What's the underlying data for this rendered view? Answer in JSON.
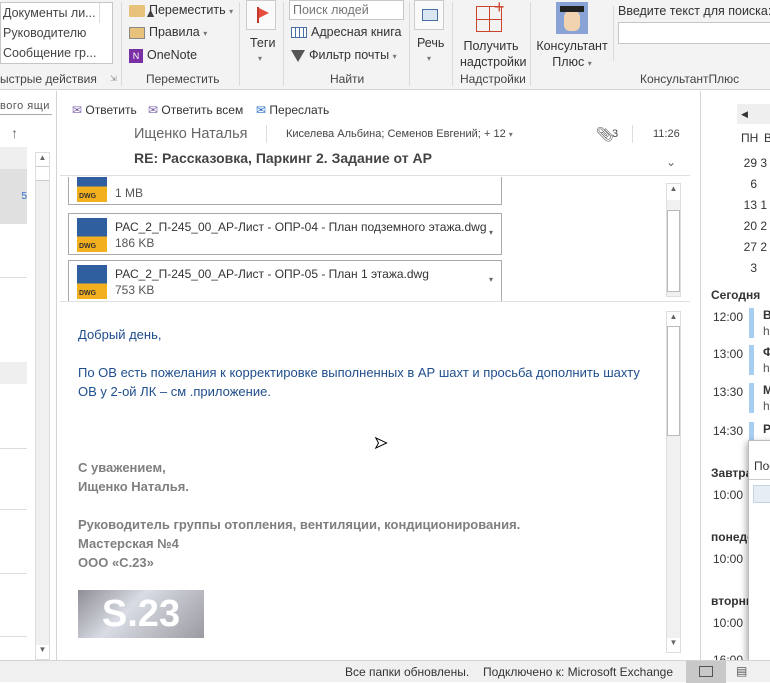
{
  "ribbon": {
    "quick_steps": [
      "Документы ли...",
      "Руководителю",
      "Сообщение гр..."
    ],
    "quick_steps_group": "ыстрые действия",
    "move": {
      "move_label": "Переместить",
      "rules_label": "Правила",
      "onenote_label": "OneNote",
      "group": "Переместить"
    },
    "tags": {
      "label": "Теги"
    },
    "find": {
      "people_placeholder": "Поиск людей",
      "address_book": "Адресная книга",
      "filter": "Фильтр почты",
      "group": "Найти"
    },
    "speech": {
      "label": "Речь"
    },
    "addins": {
      "label_line1": "Получить",
      "label_line2": "надстройки",
      "group": "Надстройки"
    },
    "consultant": {
      "label_line1": "Консультант",
      "label_line2": "Плюс",
      "search_label": "Введите текст для поиска:",
      "search_value": "",
      "group": "КонсультантПлюс"
    }
  },
  "folder_pane": {
    "header": "вого ящи",
    "sort_icon": "arrow-up"
  },
  "message": {
    "actions": {
      "reply": "Ответить",
      "reply_all": "Ответить всем",
      "forward": "Переслать"
    },
    "from": "Ищенко Наталья",
    "to": "Киселева Альбина; Семенов Евгений;",
    "more_recipients": "+ 12",
    "attachments_count": "3",
    "time": "11:26",
    "subject": "RE:  Рассказовка, Паркинг 2. Задание от АР",
    "attachments": [
      {
        "name": "",
        "size": "1 MB"
      },
      {
        "name": "РАС_2_П-245_00_АР-Лист - ОПР-04 - План подземного этажа.dwg",
        "size": "186 KB"
      },
      {
        "name": "РАС_2_П-245_00_АР-Лист - ОПР-05 - План 1 этажа.dwg",
        "size": "753 KB"
      }
    ],
    "body": {
      "greeting": "Добрый день,",
      "text": "По ОВ есть пожелания к корректировке выполненных в АР шахт и просьба дополнить шахту ОВ у 2-ой ЛК – см .приложение.",
      "sig1": "С уважением,",
      "sig2": "Ищенко Наталья.",
      "sig3": "Руководитель группы отопления, вентиляции, кондиционирования.",
      "sig4": "Мастерская №4",
      "sig5": "ООО «С.23»",
      "logo": "S.23"
    }
  },
  "calendar": {
    "weekdays": [
      "ПН",
      "В"
    ],
    "rows": [
      [
        "29",
        "3"
      ],
      [
        "6",
        ""
      ],
      [
        "13",
        "1"
      ],
      [
        "20",
        "2"
      ],
      [
        "27",
        "2"
      ],
      [
        "3",
        ""
      ]
    ],
    "today_label": "Сегодня",
    "events": [
      {
        "time": "12:00",
        "title": "В",
        "sub": "ht"
      },
      {
        "time": "13:00",
        "title": "Ф",
        "sub": "ht"
      },
      {
        "time": "13:30",
        "title": "М",
        "sub": "ht"
      },
      {
        "time": "14:30",
        "title": "Р",
        "sub": ""
      }
    ],
    "days": [
      {
        "label": "Завтра",
        "time": "10:00"
      },
      {
        "label": "понеде",
        "time": "10:00"
      },
      {
        "label": "вторни",
        "time": "10:00"
      }
    ],
    "last_time": "16:00",
    "popup_title": "Пос"
  },
  "status": {
    "updated": "Все папки обновлены.",
    "connected": "Подключено к: Microsoft Exchange"
  }
}
